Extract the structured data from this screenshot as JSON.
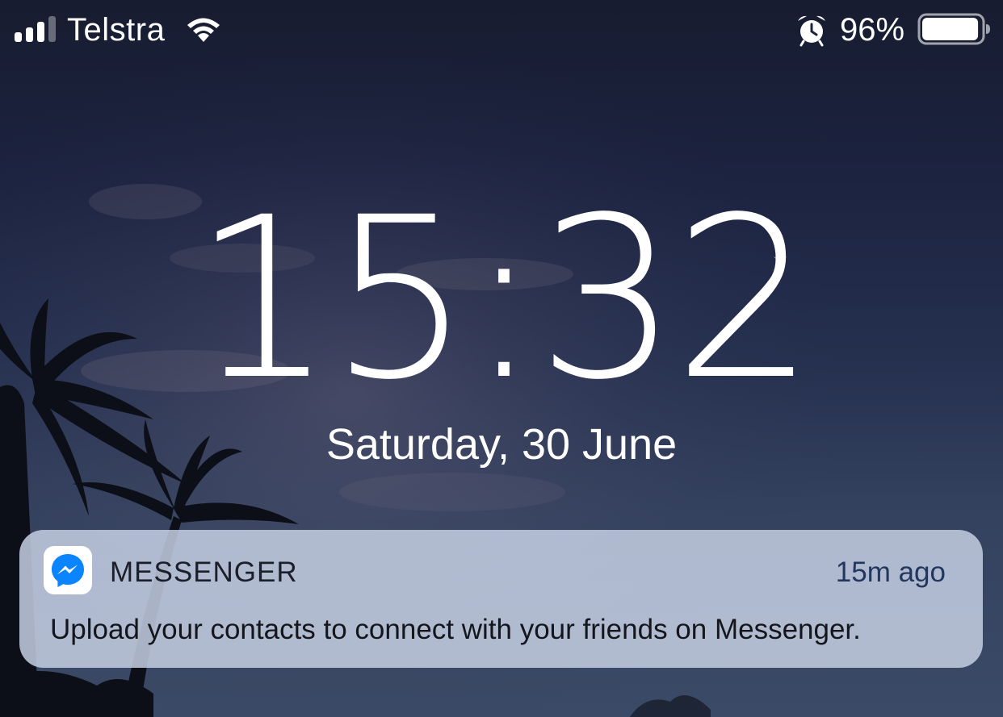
{
  "status_bar": {
    "carrier": "Telstra",
    "signal_bars_filled": 3,
    "signal_bars_total": 4,
    "battery_percent_label": "96%",
    "battery_level": 0.96,
    "icons": [
      "signal-icon",
      "wifi-icon",
      "alarm-icon",
      "battery-icon"
    ]
  },
  "lock_screen": {
    "time": "15:32",
    "date": "Saturday, 30 June"
  },
  "notification": {
    "app_name": "MESSENGER",
    "app_icon": "messenger-icon",
    "time_ago": "15m ago",
    "body": "Upload your contacts to connect with your friends on Messenger."
  },
  "colors": {
    "messenger_blue": "#0a84ff",
    "notification_bg": "#c4cee2",
    "sky_top": "#171c30",
    "sky_bottom": "#3b4a66"
  }
}
